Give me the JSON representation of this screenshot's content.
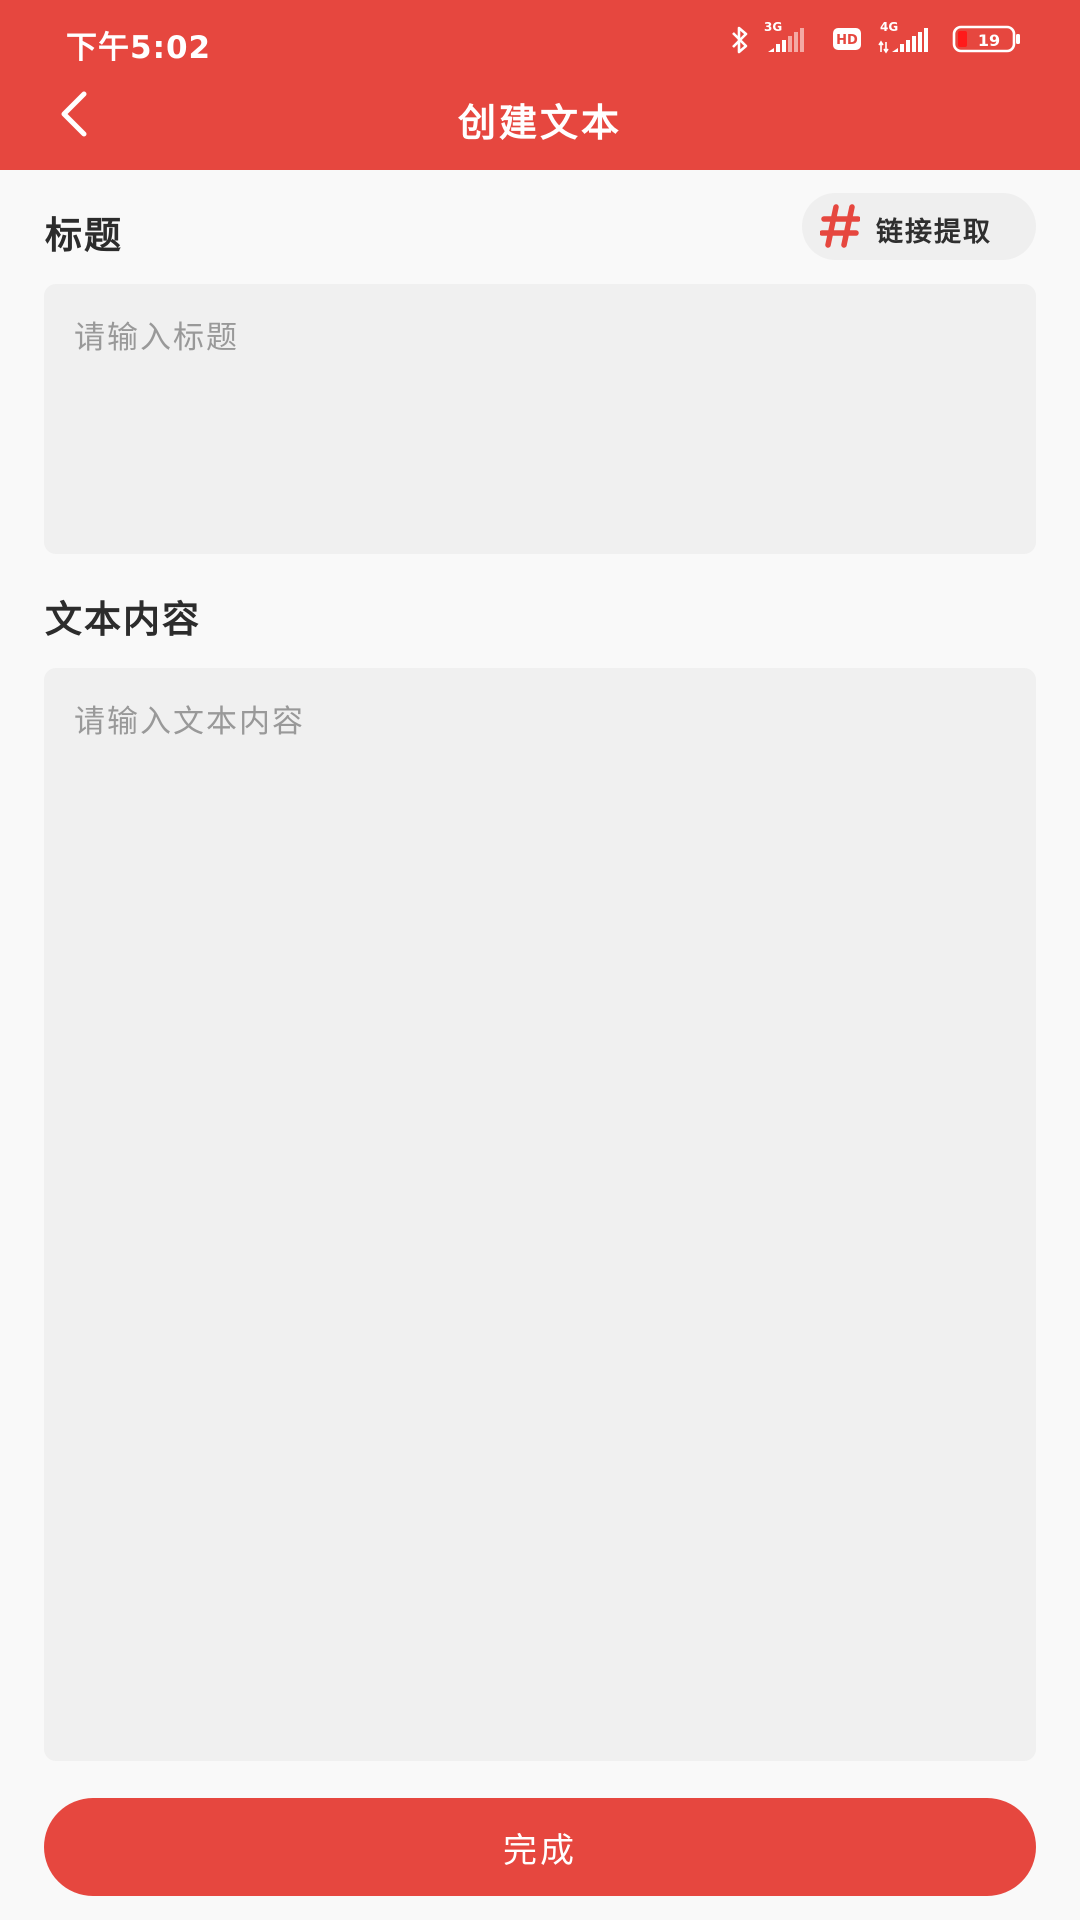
{
  "status_bar": {
    "time": "下午5:02",
    "network_1": "3G",
    "hd_badge": "HD",
    "network_2": "4G",
    "battery_level": "19",
    "icons": [
      "bluetooth-icon",
      "signal-3g-icon",
      "hd-icon",
      "signal-4g-icon",
      "battery-icon"
    ]
  },
  "toolbar": {
    "title": "创建文本",
    "back_icon": "chevron-left-icon"
  },
  "form": {
    "title_label": "标题",
    "link_extract_label": "链接提取",
    "link_extract_icon": "hash-icon",
    "title_placeholder": "请输入标题",
    "title_value": "",
    "content_label": "文本内容",
    "content_placeholder": "请输入文本内容",
    "content_value": ""
  },
  "actions": {
    "done_label": "完成"
  },
  "colors": {
    "primary": "#e6473f",
    "background": "#f9f9f9",
    "input_background": "#f0f0f0",
    "placeholder": "#999999"
  }
}
